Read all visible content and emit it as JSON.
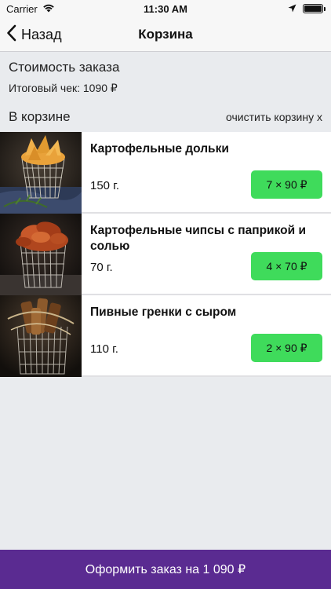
{
  "status_bar": {
    "carrier": "Carrier",
    "time": "11:30 AM"
  },
  "nav": {
    "back_label": "Назад",
    "title": "Корзина"
  },
  "summary": {
    "title": "Стоимость заказа",
    "total": "Итоговый чек: 1090 ₽"
  },
  "cart": {
    "label": "В корзине",
    "clear_label": "очистить корзину x"
  },
  "items": [
    {
      "name": "Картофельные дольки",
      "weight": "150 г.",
      "qty_price": "7 × 90 ₽"
    },
    {
      "name": "Картофельные чипсы с паприкой и солью",
      "weight": "70 г.",
      "qty_price": "4 × 70 ₽"
    },
    {
      "name": "Пивные гренки с сыром",
      "weight": "110 г.",
      "qty_price": "2 × 90 ₽"
    }
  ],
  "checkout": {
    "label": "Оформить заказ на 1 090 ₽"
  },
  "colors": {
    "accent_green": "#3fdb5b",
    "checkout_purple": "#5a2b91",
    "background": "#e9ebee"
  }
}
